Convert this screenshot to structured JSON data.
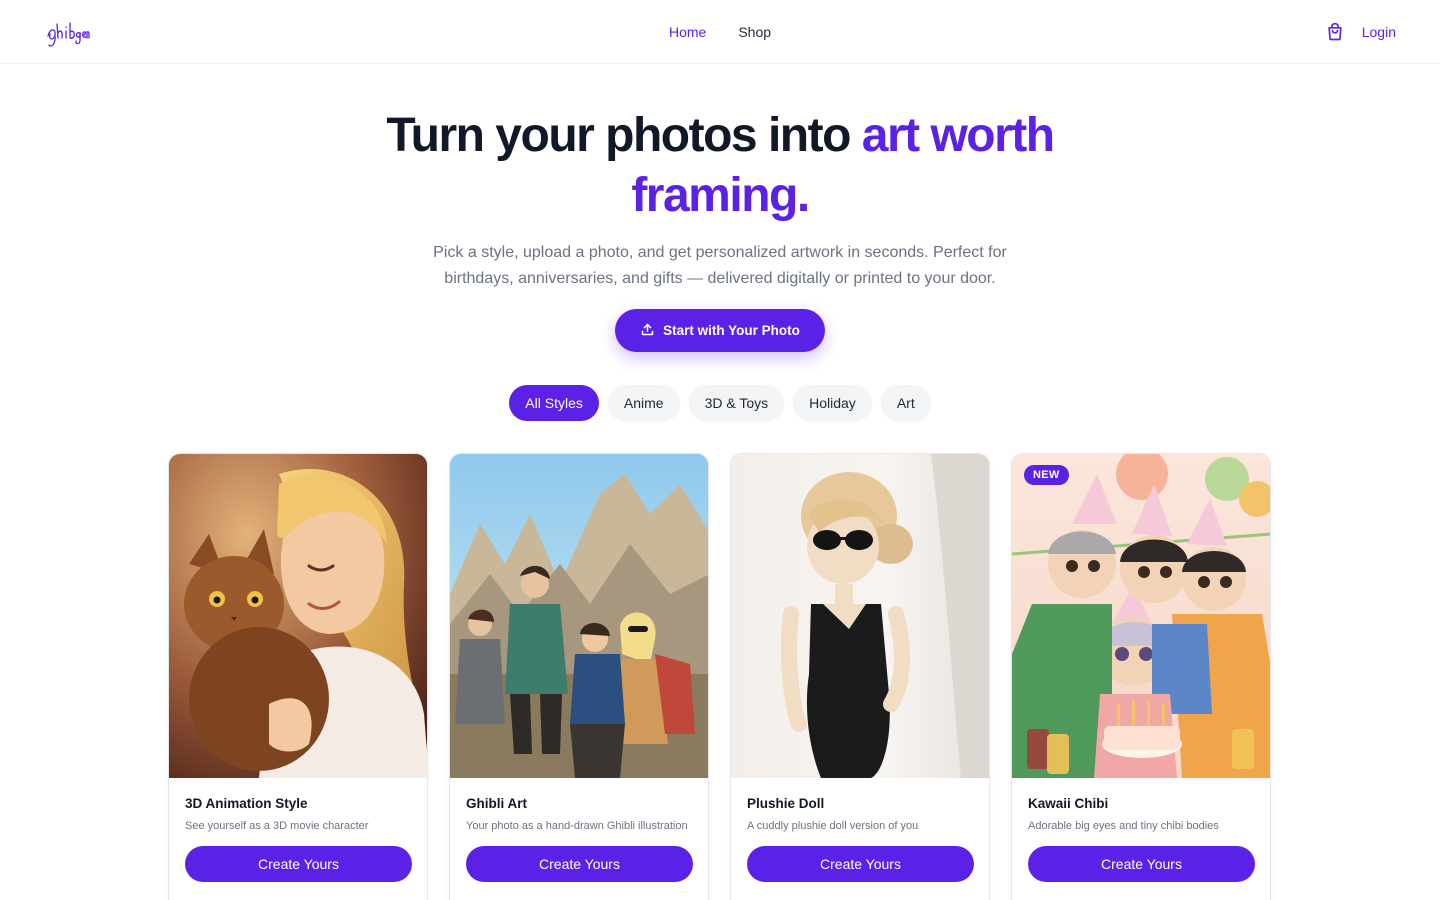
{
  "brand": {
    "logo_text": "ghibgen",
    "accent": "#5b21e6"
  },
  "nav": {
    "links": [
      {
        "label": "Home",
        "active": true
      },
      {
        "label": "Shop",
        "active": false
      }
    ],
    "cart_icon": "shopping-bag-icon",
    "login_label": "Login"
  },
  "hero": {
    "title_plain": "Turn your photos into ",
    "title_accent_1": "art worth",
    "title_accent_2": "framing.",
    "subtitle": "Pick a style, upload a photo, and get personalized artwork in seconds. Perfect for birthdays, anniversaries, and gifts — delivered digitally or printed to your door.",
    "cta_label": "Start with Your Photo",
    "cta_icon": "upload-icon"
  },
  "filters": [
    {
      "label": "All Styles",
      "active": true
    },
    {
      "label": "Anime",
      "active": false
    },
    {
      "label": "3D & Toys",
      "active": false
    },
    {
      "label": "Holiday",
      "active": false
    },
    {
      "label": "Art",
      "active": false
    }
  ],
  "cards": [
    {
      "title": "3D Animation Style",
      "description": "See yourself as a 3D movie character",
      "button": "Create Yours",
      "badge": ""
    },
    {
      "title": "Ghibli Art",
      "description": "Your photo as a hand-drawn Ghibli illustration",
      "button": "Create Yours",
      "badge": ""
    },
    {
      "title": "Plushie Doll",
      "description": "A cuddly plushie doll version of you",
      "button": "Create Yours",
      "badge": ""
    },
    {
      "title": "Kawaii Chibi",
      "description": "Adorable big eyes and tiny chibi bodies",
      "button": "Create Yours",
      "badge": "NEW"
    }
  ]
}
